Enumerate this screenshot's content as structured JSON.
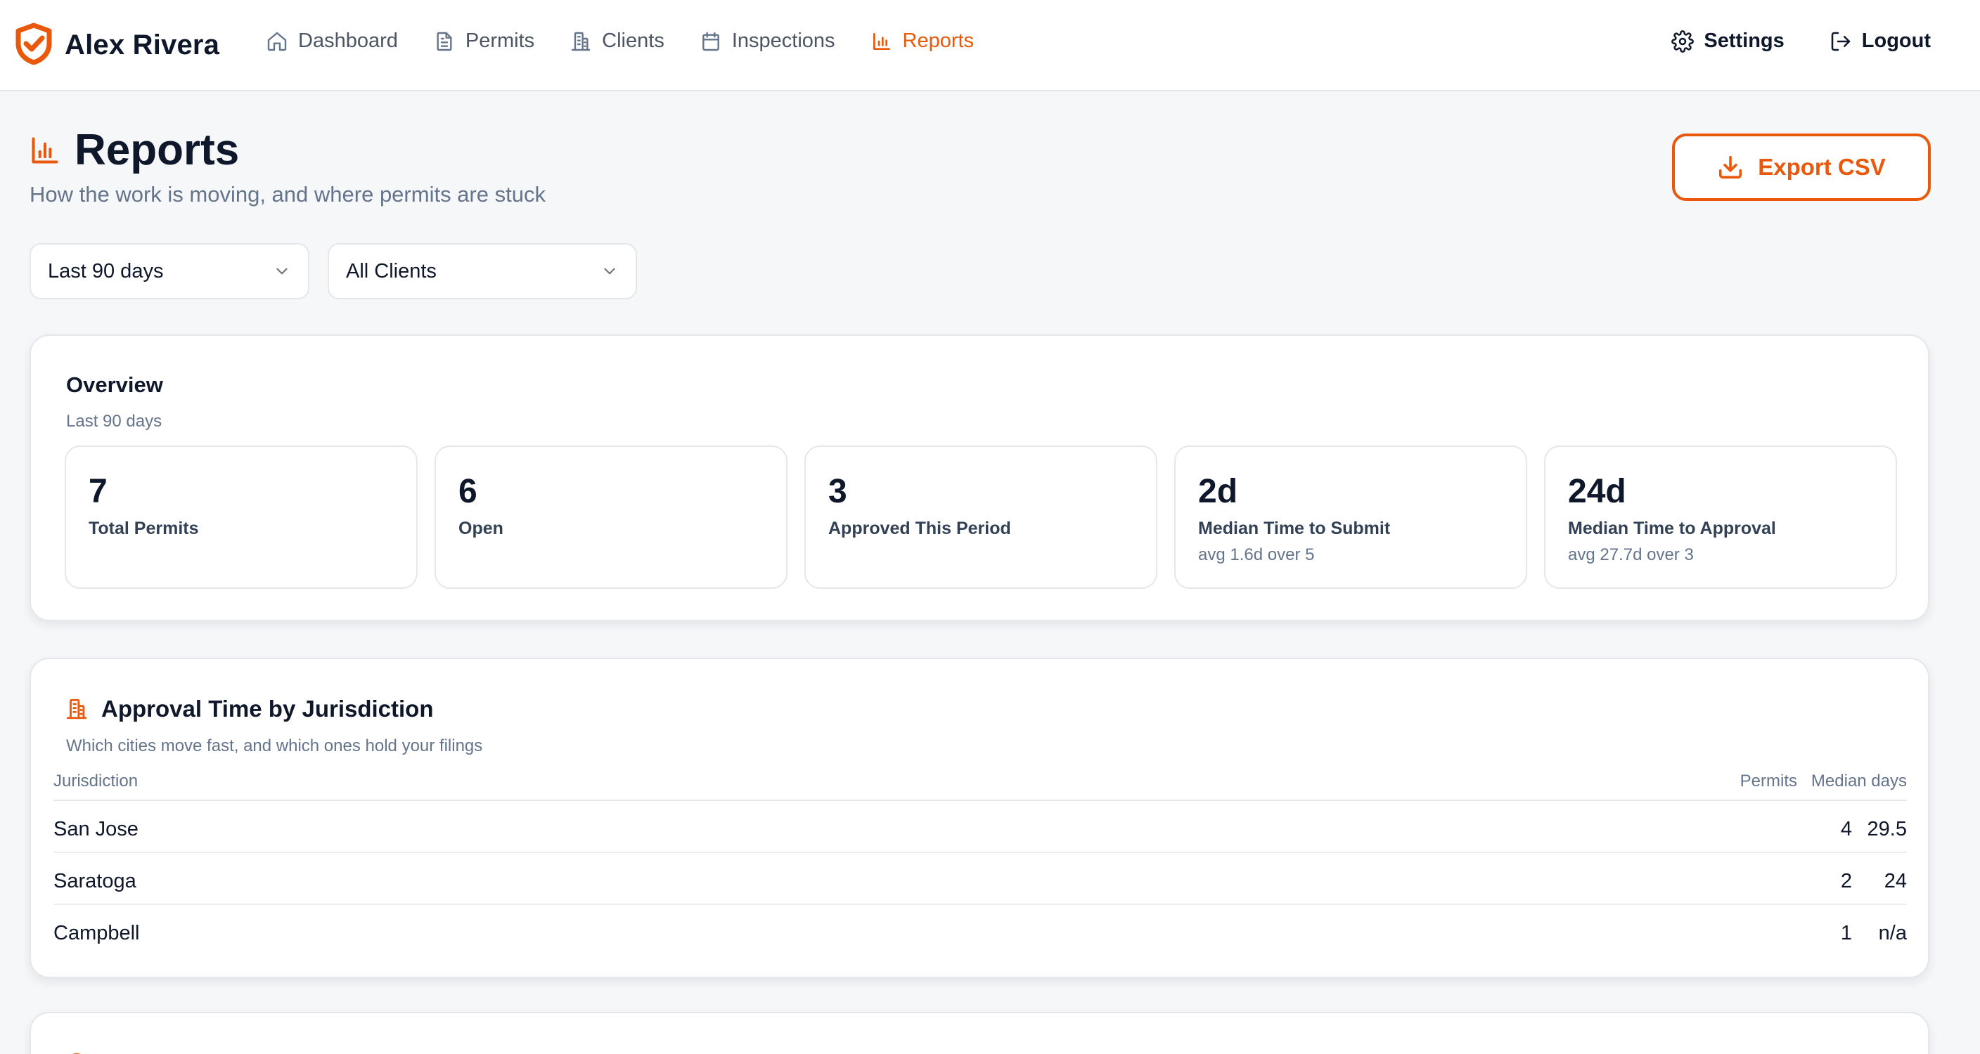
{
  "app": {
    "user_name": "Alex Rivera",
    "accent_color": "#ea580c"
  },
  "nav": {
    "items": [
      {
        "label": "Dashboard",
        "icon": "home-icon",
        "active": false
      },
      {
        "label": "Permits",
        "icon": "document-icon",
        "active": false
      },
      {
        "label": "Clients",
        "icon": "building-icon",
        "active": false
      },
      {
        "label": "Inspections",
        "icon": "calendar-icon",
        "active": false
      },
      {
        "label": "Reports",
        "icon": "bar-chart-icon",
        "active": true
      }
    ],
    "settings_label": "Settings",
    "logout_label": "Logout"
  },
  "page": {
    "title": "Reports",
    "subtitle": "How the work is moving, and where permits are stuck",
    "export_label": "Export CSV"
  },
  "filters": {
    "period": "Last 90 days",
    "client": "All Clients"
  },
  "overview": {
    "title": "Overview",
    "subtitle": "Last 90 days",
    "stats": [
      {
        "value": "7",
        "label": "Total Permits",
        "note": ""
      },
      {
        "value": "6",
        "label": "Open",
        "note": ""
      },
      {
        "value": "3",
        "label": "Approved This Period",
        "note": ""
      },
      {
        "value": "2d",
        "label": "Median Time to Submit",
        "note": "avg 1.6d over 5"
      },
      {
        "value": "24d",
        "label": "Median Time to Approval",
        "note": "avg 27.7d over 3"
      }
    ]
  },
  "jurisdiction": {
    "title": "Approval Time by Jurisdiction",
    "subtitle": "Which cities move fast, and which ones hold your filings",
    "columns": [
      "Jurisdiction",
      "Permits",
      "Median days"
    ],
    "rows": [
      {
        "name": "San Jose",
        "permits": "4",
        "median": "29.5"
      },
      {
        "name": "Saratoga",
        "permits": "2",
        "median": "24"
      },
      {
        "name": "Campbell",
        "permits": "1",
        "median": "n/a"
      }
    ]
  }
}
